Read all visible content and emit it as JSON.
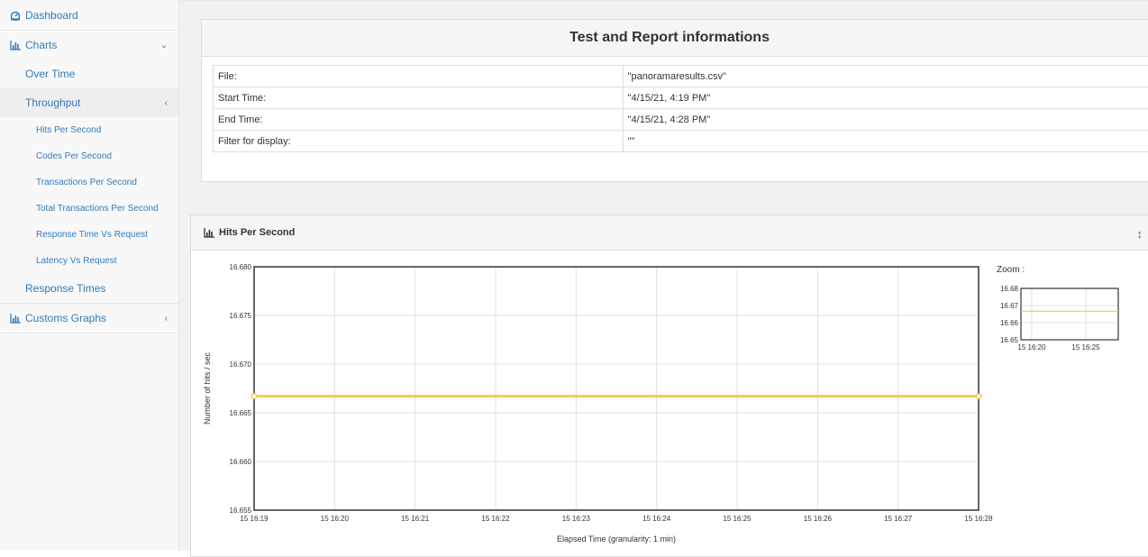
{
  "sidebar": {
    "dashboard": "Dashboard",
    "charts": "Charts",
    "over_time": "Over Time",
    "throughput": "Throughput",
    "sub_items": [
      "Hits Per Second",
      "Codes Per Second",
      "Transactions Per Second",
      "Total Transactions Per Second",
      "Response Time Vs Request",
      "Latency Vs Request"
    ],
    "response_times": "Response Times",
    "custom_graphs": "Customs Graphs"
  },
  "info_panel": {
    "title": "Test and Report informations",
    "rows": [
      {
        "key": "File:",
        "value": "\"panoramaresults.csv\""
      },
      {
        "key": "Start Time:",
        "value": "\"4/15/21, 4:19 PM\""
      },
      {
        "key": "End Time:",
        "value": "\"4/15/21, 4:28 PM\""
      },
      {
        "key": "Filter for display:",
        "value": "\"\""
      }
    ]
  },
  "chart_panel": {
    "title": "Hits Per Second",
    "zoom_label": "Zoom :"
  },
  "colors": {
    "link": "#337ab7",
    "series": "#edc240"
  },
  "chart_data": [
    {
      "type": "line",
      "xlabel": "Elapsed Time (granularity: 1 min)",
      "ylabel": "Number of hits / sec",
      "x_ticks": [
        "15 16:19",
        "15 16:20",
        "15 16:21",
        "15 16:22",
        "15 16:23",
        "15 16:24",
        "15 16:25",
        "15 16:26",
        "15 16:27",
        "15 16:28"
      ],
      "y_ticks": [
        "16.655",
        "16.660",
        "16.665",
        "16.670",
        "16.675",
        "16.680"
      ],
      "ylim": [
        16.655,
        16.68
      ],
      "series": [
        {
          "x": [
            "15 16:19",
            "15 16:28"
          ],
          "values": [
            16.6667,
            16.6667
          ]
        }
      ],
      "grid": true
    },
    {
      "type": "line",
      "name": "zoom",
      "x_ticks": [
        "15 16:20",
        "15 16:25"
      ],
      "y_ticks": [
        "16.65",
        "16.66",
        "16.67",
        "16.68"
      ],
      "ylim": [
        16.65,
        16.68
      ],
      "series": [
        {
          "values": [
            16.6667,
            16.6667
          ]
        }
      ]
    }
  ]
}
